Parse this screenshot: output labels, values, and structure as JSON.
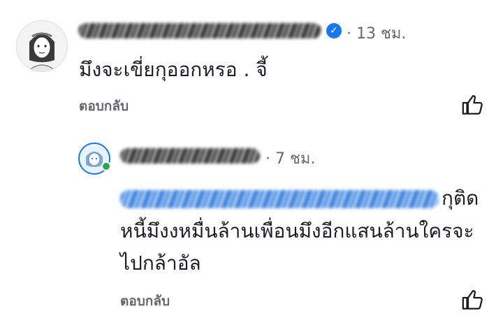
{
  "comments": [
    {
      "time": "· 13 ชม.",
      "text_lines": [
        "มึงจะเขี่ยกุออกหรอ . จี้"
      ],
      "reply_label": "ตอบกลับ",
      "verified": true
    },
    {
      "time": "· 7 ชม.",
      "text_lines": [
        "กุติด",
        "หนี้มึงงหมื่นล้านเพื่อนมึงอีกแสนล้านใครจะ",
        "ไปกล้าอัล"
      ],
      "reply_label": "ตอบกลับ"
    }
  ],
  "icons": {
    "verified": "verified-badge-icon",
    "like": "thumbs-up-icon"
  },
  "colors": {
    "meta_text": "#65676b",
    "verified": "#1877f2",
    "online": "#31a24c"
  }
}
